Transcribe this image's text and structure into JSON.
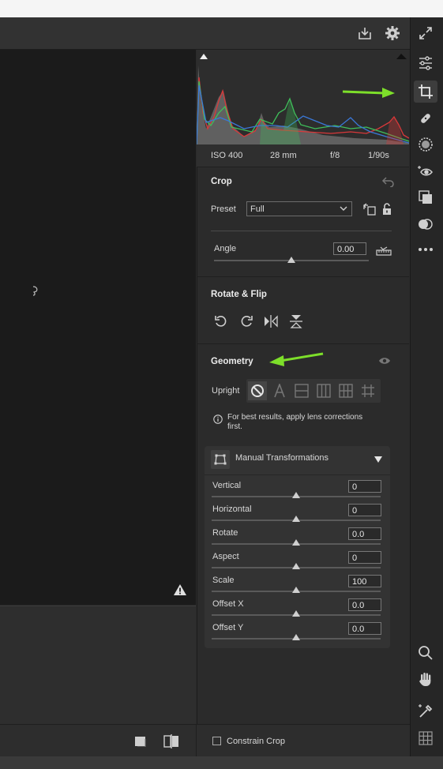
{
  "exif": {
    "iso": "ISO 400",
    "focal": "28 mm",
    "aperture": "f/8",
    "shutter": "1/90s"
  },
  "crop": {
    "title": "Crop",
    "preset_label": "Preset",
    "preset_value": "Full",
    "angle_label": "Angle",
    "angle_value": "0.00",
    "angle_level": 0.5
  },
  "rotate": {
    "title": "Rotate & Flip"
  },
  "geometry": {
    "title": "Geometry",
    "upright_label": "Upright",
    "note_line1": "For best results, apply lens corrections",
    "note_line2": "first.",
    "manual_title": "Manual Transformations",
    "sliders": [
      {
        "label": "Vertical",
        "value": "0",
        "level": 0.5
      },
      {
        "label": "Horizontal",
        "value": "0",
        "level": 0.5
      },
      {
        "label": "Rotate",
        "value": "0.0",
        "level": 0.5
      },
      {
        "label": "Aspect",
        "value": "0",
        "level": 0.5
      },
      {
        "label": "Scale",
        "value": "100",
        "level": 0.5
      },
      {
        "label": "Offset X",
        "value": "0.0",
        "level": 0.5
      },
      {
        "label": "Offset Y",
        "value": "0.0",
        "level": 0.5
      }
    ]
  },
  "bottom": {
    "constrain_label": "Constrain Crop"
  },
  "colors": {
    "arrow": "#7ddf2a",
    "histo_red": "#d9383a",
    "histo_green": "#3fbf5a",
    "histo_blue": "#3a78d8"
  },
  "icons": [
    "save-icon",
    "gear-icon",
    "fullscreen-icon",
    "edit-sliders-icon",
    "crop-icon",
    "healing-icon",
    "mask-icon",
    "redeye-icon",
    "presets-icon",
    "snapshots-icon",
    "more-icon",
    "zoom-icon",
    "hand-icon",
    "color-sampler-icon",
    "grid-icon",
    "warning-icon",
    "undo-icon",
    "rotate-left-icon",
    "rotate-right-icon",
    "flip-horizontal-icon",
    "flip-vertical-icon",
    "eye-icon",
    "info-icon",
    "lock-icon"
  ]
}
